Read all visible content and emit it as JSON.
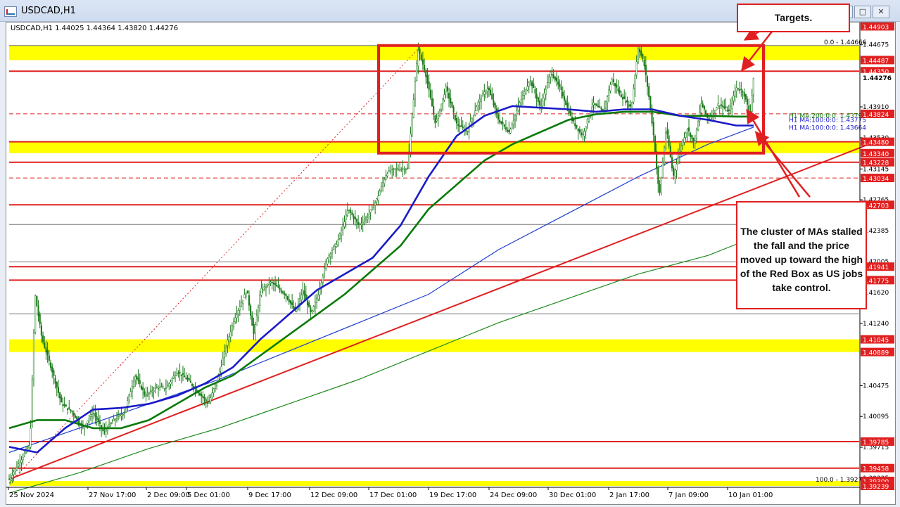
{
  "window": {
    "title": "USDCAD,H1",
    "icon": "chart-window-icon",
    "buttons": [
      "minimize",
      "maximize",
      "close"
    ]
  },
  "chart_header": {
    "symbol_text": "USDCAD,H1  1.44025 1.44364 1.43820 1.44276"
  },
  "annotations": {
    "targets": "Targets.",
    "cluster": "The cluster of MAs stalled the fall and the price moved up toward the high of the Red Box as US jobs take control."
  },
  "colors": {
    "red": "#e02020",
    "yellow": "#ffff00",
    "ma100": "#1a1ac8",
    "ma200": "#0a7a0a",
    "blue_env": "#1f3fd0",
    "green_env": "#1e8a1e",
    "candle_up": "#1a7a1a",
    "candle_down": "#1a7a1a"
  },
  "chart_data": {
    "type": "candlestick",
    "symbol": "USDCAD",
    "timeframe": "H1",
    "ohlc_current": {
      "open": 1.44025,
      "high": 1.44364,
      "low": 1.4382,
      "close": 1.44276
    },
    "x_tick_labels": [
      "25 Nov 2024",
      "27 Nov 17:00",
      "2 Dec 09:00",
      "5 Dec 01:00",
      "9 Dec 17:00",
      "12 Dec 09:00",
      "17 Dec 01:00",
      "19 Dec 17:00",
      "24 Dec 09:00",
      "30 Dec 01:00",
      "2 Jan 17:00",
      "7 Jan 09:00",
      "10 Jan 01:00"
    ],
    "y_range": [
      1.3923,
      1.4495
    ],
    "y_tick_labels": [
      {
        "label": "1.44675",
        "value": 1.44675
      },
      {
        "label": "1.43910",
        "value": 1.4391
      },
      {
        "label": "1.43530",
        "value": 1.4353
      },
      {
        "label": "1.43145",
        "value": 1.43145
      },
      {
        "label": "1.42765",
        "value": 1.42765
      },
      {
        "label": "1.42385",
        "value": 1.42385
      },
      {
        "label": "1.42005",
        "value": 1.42005
      },
      {
        "label": "1.41620",
        "value": 1.4162
      },
      {
        "label": "1.41240",
        "value": 1.4124
      },
      {
        "label": "1.40475",
        "value": 1.40475
      },
      {
        "label": "1.40095",
        "value": 1.40095
      },
      {
        "label": "1.39715",
        "value": 1.39715
      },
      {
        "label": "1.39335",
        "value": 1.39335
      }
    ],
    "price_tags": [
      {
        "label": "1.44903",
        "value": 1.44903
      },
      {
        "label": "1.44487",
        "value": 1.44487
      },
      {
        "label": "1.44350",
        "value": 1.4435
      },
      {
        "label": "1.44276",
        "value": 1.44276,
        "current": true
      },
      {
        "label": "1.43824",
        "value": 1.43824
      },
      {
        "label": "1.43480",
        "value": 1.4348
      },
      {
        "label": "1.43340",
        "value": 1.4334
      },
      {
        "label": "1.43228",
        "value": 1.43228
      },
      {
        "label": "1.43034",
        "value": 1.43034
      },
      {
        "label": "1.42703",
        "value": 1.42703
      },
      {
        "label": "1.41941",
        "value": 1.41941
      },
      {
        "label": "1.41775",
        "value": 1.41775
      },
      {
        "label": "1.41045",
        "value": 1.41045
      },
      {
        "label": "1.40889",
        "value": 1.40889
      },
      {
        "label": "1.39785",
        "value": 1.39785
      },
      {
        "label": "1.39458",
        "value": 1.39458
      },
      {
        "label": "1.39300",
        "value": 1.393
      },
      {
        "label": "1.39239",
        "value": 1.39239
      }
    ],
    "horizontal_lines": [
      1.4435,
      1.4348,
      1.43228,
      1.42703,
      1.41941,
      1.41775,
      1.39785,
      1.39458
    ],
    "dashed_lines": [
      1.43824,
      1.43034
    ],
    "yellow_zones": [
      [
        1.44487,
        1.44666
      ],
      [
        1.4334,
        1.4348
      ],
      [
        1.40889,
        1.41045
      ],
      [
        1.39239,
        1.393
      ]
    ],
    "red_box": {
      "high": 1.44666,
      "low": 1.4334
    },
    "fibonacci": [
      {
        "label": "0.0 - 1.44666",
        "value": 1.44666
      },
      {
        "label": "100.0 - 1.39272",
        "value": 1.39272
      }
    ],
    "moving_averages": [
      {
        "label": "H1 MA:200:0:0: 1.43795",
        "value": 1.43795
      },
      {
        "label": "H1 MA:100:0:0: 1.43775",
        "value": 1.43775
      },
      {
        "label": "H1 MA:100:0:0: 1.43664",
        "value": 1.43664
      }
    ],
    "price_path": [
      [
        0,
        1.3932
      ],
      [
        30,
        1.3975
      ],
      [
        37,
        1.416
      ],
      [
        47,
        1.4105
      ],
      [
        60,
        1.407
      ],
      [
        75,
        1.4025
      ],
      [
        90,
        1.4015
      ],
      [
        105,
        1.3995
      ],
      [
        120,
        1.4015
      ],
      [
        135,
        1.399
      ],
      [
        150,
        1.4005
      ],
      [
        165,
        1.4015
      ],
      [
        180,
        1.406
      ],
      [
        195,
        1.4035
      ],
      [
        210,
        1.4045
      ],
      [
        225,
        1.4045
      ],
      [
        240,
        1.4065
      ],
      [
        255,
        1.4055
      ],
      [
        270,
        1.404
      ],
      [
        285,
        1.4025
      ],
      [
        300,
        1.406
      ],
      [
        310,
        1.4095
      ],
      [
        322,
        1.413
      ],
      [
        340,
        1.4165
      ],
      [
        350,
        1.411
      ],
      [
        360,
        1.4165
      ],
      [
        375,
        1.4175
      ],
      [
        395,
        1.416
      ],
      [
        410,
        1.4138
      ],
      [
        420,
        1.4165
      ],
      [
        432,
        1.4135
      ],
      [
        442,
        1.416
      ],
      [
        455,
        1.4205
      ],
      [
        470,
        1.4225
      ],
      [
        485,
        1.4265
      ],
      [
        500,
        1.4245
      ],
      [
        512,
        1.4255
      ],
      [
        525,
        1.4275
      ],
      [
        540,
        1.431
      ],
      [
        555,
        1.4315
      ],
      [
        570,
        1.4315
      ],
      [
        578,
        1.4395
      ],
      [
        585,
        1.4462
      ],
      [
        595,
        1.4435
      ],
      [
        610,
        1.437
      ],
      [
        625,
        1.4415
      ],
      [
        640,
        1.437
      ],
      [
        655,
        1.436
      ],
      [
        670,
        1.4395
      ],
      [
        685,
        1.4415
      ],
      [
        700,
        1.4375
      ],
      [
        715,
        1.436
      ],
      [
        730,
        1.4395
      ],
      [
        745,
        1.4425
      ],
      [
        760,
        1.439
      ],
      [
        775,
        1.4435
      ],
      [
        790,
        1.441
      ],
      [
        805,
        1.4375
      ],
      [
        820,
        1.4355
      ],
      [
        835,
        1.4395
      ],
      [
        850,
        1.4385
      ],
      [
        862,
        1.4425
      ],
      [
        875,
        1.4405
      ],
      [
        890,
        1.439
      ],
      [
        900,
        1.4465
      ],
      [
        908,
        1.4445
      ],
      [
        915,
        1.4405
      ],
      [
        922,
        1.4355
      ],
      [
        930,
        1.428
      ],
      [
        940,
        1.4365
      ],
      [
        950,
        1.4305
      ],
      [
        960,
        1.434
      ],
      [
        970,
        1.4365
      ],
      [
        980,
        1.4345
      ],
      [
        990,
        1.4395
      ],
      [
        1000,
        1.4375
      ],
      [
        1015,
        1.4395
      ],
      [
        1030,
        1.4385
      ],
      [
        1040,
        1.4415
      ],
      [
        1050,
        1.441
      ],
      [
        1060,
        1.4382
      ],
      [
        1065,
        1.4428
      ]
    ],
    "ma100_path": [
      [
        0,
        1.3972
      ],
      [
        40,
        1.3965
      ],
      [
        80,
        1.3995
      ],
      [
        120,
        1.4018
      ],
      [
        160,
        1.402
      ],
      [
        200,
        1.4025
      ],
      [
        240,
        1.4035
      ],
      [
        280,
        1.405
      ],
      [
        320,
        1.407
      ],
      [
        360,
        1.4105
      ],
      [
        400,
        1.4135
      ],
      [
        440,
        1.4165
      ],
      [
        480,
        1.4185
      ],
      [
        520,
        1.4205
      ],
      [
        560,
        1.4245
      ],
      [
        600,
        1.4305
      ],
      [
        640,
        1.4355
      ],
      [
        680,
        1.438
      ],
      [
        720,
        1.4392
      ],
      [
        760,
        1.439
      ],
      [
        800,
        1.4388
      ],
      [
        840,
        1.4385
      ],
      [
        880,
        1.4388
      ],
      [
        920,
        1.4388
      ],
      [
        960,
        1.438
      ],
      [
        1000,
        1.4375
      ],
      [
        1040,
        1.4368
      ],
      [
        1065,
        1.4368
      ]
    ],
    "ma200_path": [
      [
        0,
        1.3995
      ],
      [
        40,
        1.4005
      ],
      [
        80,
        1.4005
      ],
      [
        120,
        1.3995
      ],
      [
        160,
        1.3995
      ],
      [
        200,
        1.4005
      ],
      [
        240,
        1.4025
      ],
      [
        280,
        1.4045
      ],
      [
        320,
        1.406
      ],
      [
        360,
        1.4085
      ],
      [
        400,
        1.411
      ],
      [
        440,
        1.4135
      ],
      [
        480,
        1.416
      ],
      [
        520,
        1.419
      ],
      [
        560,
        1.422
      ],
      [
        600,
        1.4265
      ],
      [
        640,
        1.4295
      ],
      [
        680,
        1.4325
      ],
      [
        720,
        1.4345
      ],
      [
        760,
        1.436
      ],
      [
        800,
        1.4375
      ],
      [
        840,
        1.4382
      ],
      [
        880,
        1.4385
      ],
      [
        920,
        1.4385
      ],
      [
        960,
        1.438
      ],
      [
        1000,
        1.438
      ],
      [
        1040,
        1.4379
      ],
      [
        1065,
        1.4379
      ]
    ],
    "blue_env_path": [
      [
        0,
        1.3965
      ],
      [
        100,
        1.3995
      ],
      [
        200,
        1.4025
      ],
      [
        300,
        1.4055
      ],
      [
        400,
        1.409
      ],
      [
        500,
        1.4125
      ],
      [
        600,
        1.416
      ],
      [
        700,
        1.4215
      ],
      [
        800,
        1.426
      ],
      [
        900,
        1.4305
      ],
      [
        1000,
        1.4345
      ],
      [
        1065,
        1.4366
      ]
    ],
    "green_env_path": [
      [
        0,
        1.3915
      ],
      [
        100,
        1.394
      ],
      [
        200,
        1.397
      ],
      [
        300,
        1.3995
      ],
      [
        400,
        1.4025
      ],
      [
        500,
        1.4055
      ],
      [
        600,
        1.409
      ],
      [
        700,
        1.4125
      ],
      [
        800,
        1.4155
      ],
      [
        900,
        1.4185
      ],
      [
        1000,
        1.4208
      ],
      [
        1050,
        1.4225
      ]
    ],
    "trendline": [
      [
        0,
        1.3932
      ],
      [
        1230,
        1.4345
      ]
    ],
    "fib_diagonal": [
      [
        0,
        1.3927
      ],
      [
        590,
        1.4467
      ]
    ],
    "red_arrows": [
      {
        "from": [
          1100,
          1.4495
        ],
        "to": [
          1060,
          1.4475
        ]
      },
      {
        "from": [
          1115,
          1.4505
        ],
        "to": [
          1055,
          1.4438
        ]
      },
      {
        "from": [
          1135,
          1.428
        ],
        "to": [
          1062,
          1.4385
        ]
      },
      {
        "from": [
          1150,
          1.428
        ],
        "to": [
          1075,
          1.4358
        ]
      }
    ]
  }
}
